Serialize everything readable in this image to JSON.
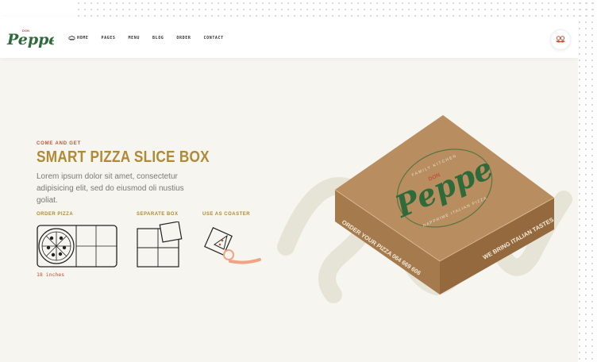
{
  "brand": {
    "name": "Peppe",
    "badge": "DON"
  },
  "nav": {
    "items": [
      {
        "label": "HOME"
      },
      {
        "label": "PAGES"
      },
      {
        "label": "MENU"
      },
      {
        "label": "BLOG"
      },
      {
        "label": "ORDER"
      },
      {
        "label": "CONTACT"
      }
    ]
  },
  "hero": {
    "eyebrow": "COME AND GET",
    "title": "SMART PIZZA SLICE BOX",
    "description": "Lorem ipsum dolor sit amet, consectetur adipisicing elit, sed do eiusmod oli nustius goliat."
  },
  "features": [
    {
      "label": "ORDER PIZZA"
    },
    {
      "label": "SEPARATE BOX"
    },
    {
      "label": "USE AS COASTER"
    }
  ],
  "size_note": "18 inches",
  "box_print": {
    "brand": "Peppe",
    "badge": "DON",
    "arc_top": "FAMILY KITCHEN",
    "arc_bottom": "NAPPRIME ITALIAN PIZZA",
    "phone_side": "ORDER YOUR PIZZA 064 669 606",
    "slogan_side": "WE BRING ITALIAN TASTES"
  },
  "icons": {
    "chef": "chef-hat-icon",
    "cart": "mustache-icon",
    "pizza": "pizza-icon",
    "slice": "pizza-slice-icon"
  },
  "colors": {
    "brand_green": "#2f6b3a",
    "accent_red": "#c0553a",
    "gold": "#b08a34",
    "background": "#f6f5f0",
    "box_kraft": "#b88d5f"
  }
}
